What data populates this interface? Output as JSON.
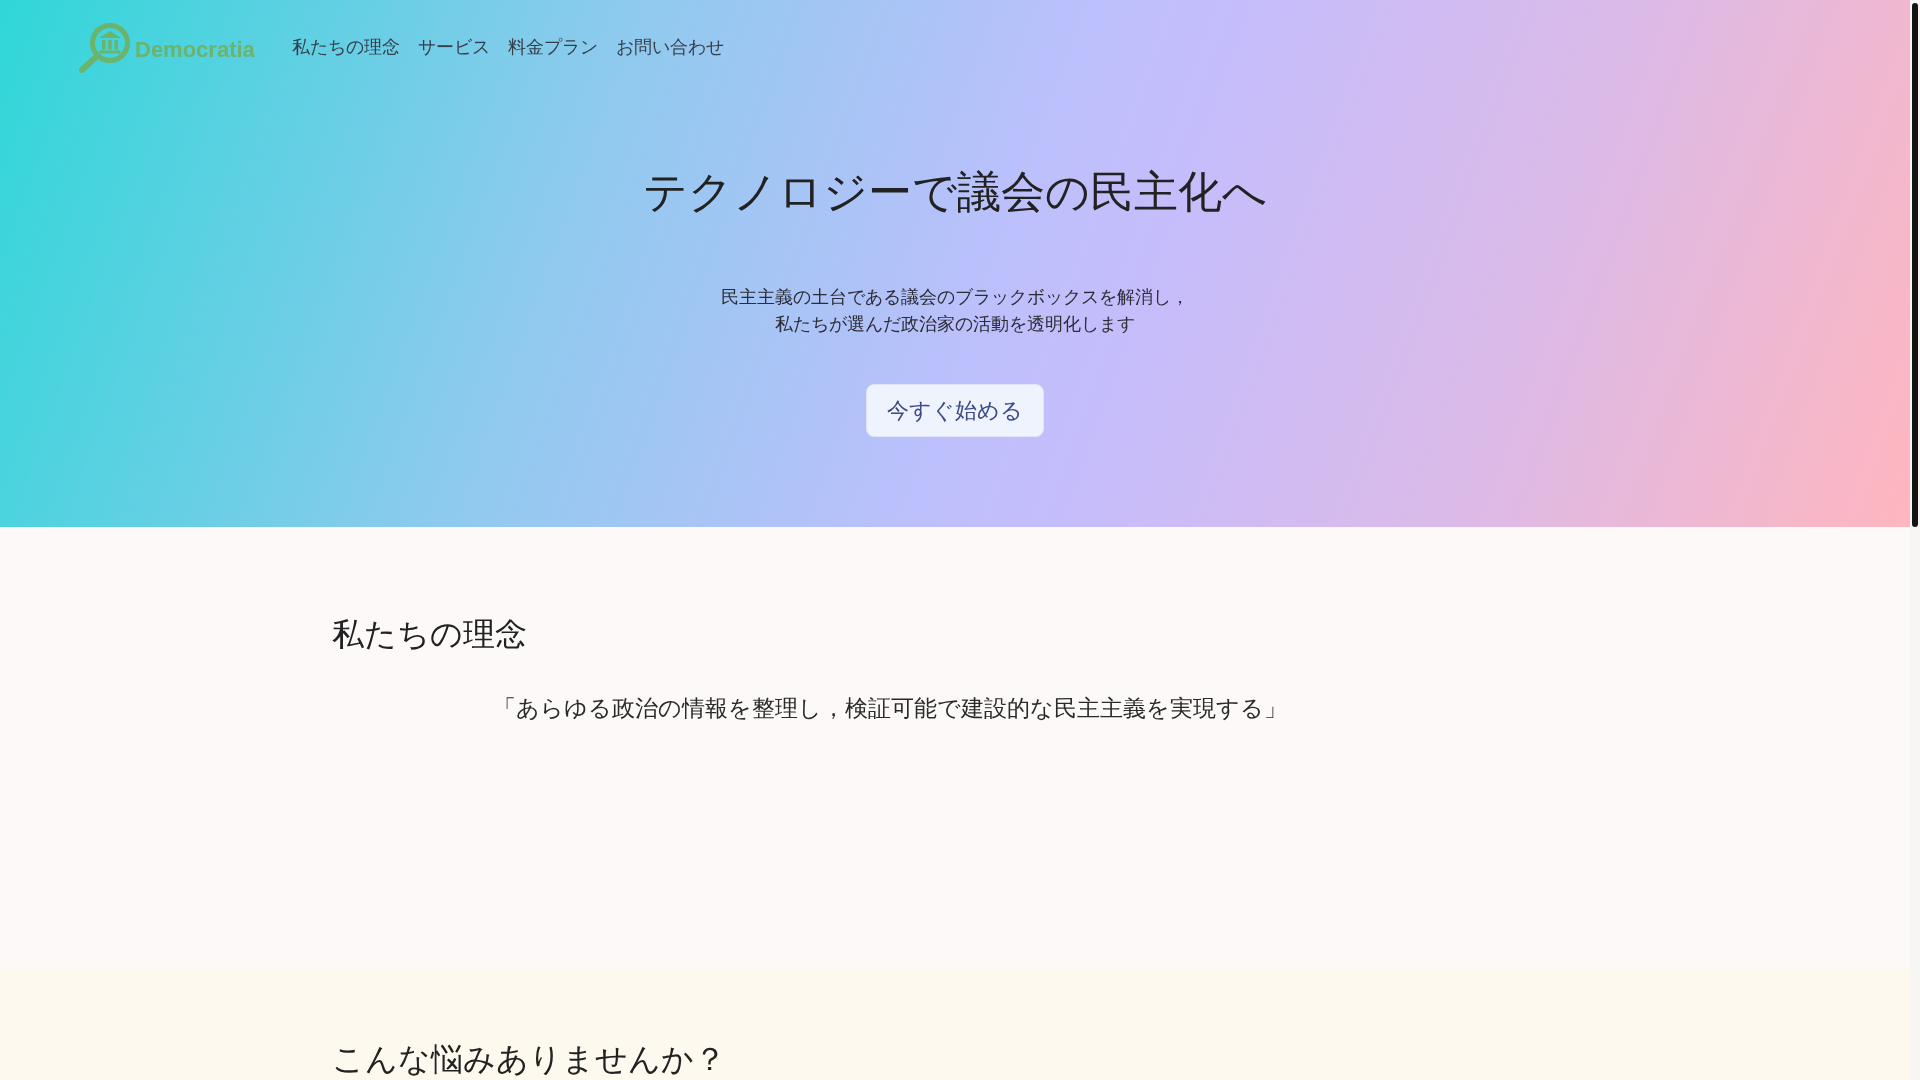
{
  "header": {
    "logo": {
      "text": "Democratia"
    },
    "nav": [
      {
        "label": "私たちの理念"
      },
      {
        "label": "サービス"
      },
      {
        "label": "料金プラン"
      },
      {
        "label": "お問い合わせ"
      }
    ]
  },
  "hero": {
    "title": "テクノロジーで議会の民主化へ",
    "lead": [
      "民主主義の土台である議会のブラックボックスを解消し，",
      "私たちが選んだ政治家の活動を透明化します"
    ],
    "cta": "今すぐ始める"
  },
  "sections": [
    {
      "kind": "philosophy",
      "heading": "私たちの理念",
      "quote": "「あらゆる政治の情報を整理し，検証可能で建設的な民主主義を実現する」"
    },
    {
      "kind": "problems",
      "heading": "こんな悩みありませんか？"
    }
  ]
}
